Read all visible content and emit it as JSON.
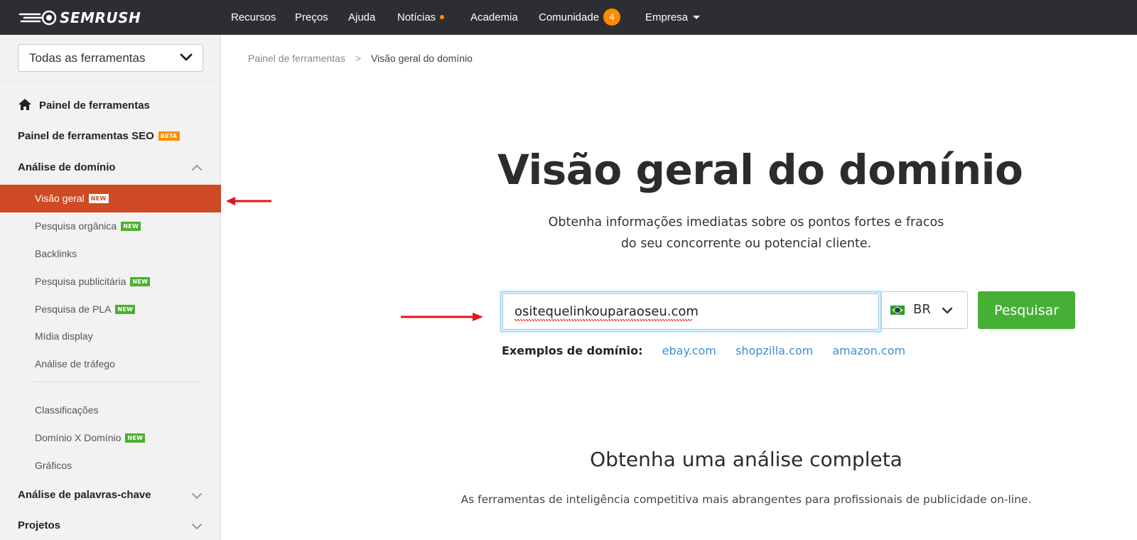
{
  "brand": {
    "logo_text": "SEMRUSH"
  },
  "topnav": {
    "items": [
      {
        "label": "Recursos"
      },
      {
        "label": "Preços"
      },
      {
        "label": "Ajuda"
      },
      {
        "label": "Notícias"
      },
      {
        "label": "Academia"
      },
      {
        "label": "Comunidade",
        "count": "4"
      },
      {
        "label": "Empresa"
      }
    ]
  },
  "sidebar": {
    "tool_select": "Todas as ferramentas",
    "items": [
      {
        "label": "Painel de ferramentas"
      },
      {
        "label": "Painel de ferramentas SEO",
        "badge": "BETA"
      },
      {
        "label": "Análise de domínio"
      },
      {
        "label": "Visão geral",
        "badge": "NEW",
        "active": true
      },
      {
        "label": "Pesquisa orgânica",
        "badge": "NEW"
      },
      {
        "label": "Backlinks"
      },
      {
        "label": "Pesquisa publicitária",
        "badge": "NEW"
      },
      {
        "label": "Pesquisa de PLA",
        "badge": "NEW"
      },
      {
        "label": "Mídia display"
      },
      {
        "label": "Análise de tráfego"
      },
      {
        "label": "Classificações"
      },
      {
        "label": "Domínio X Domínio",
        "badge": "NEW"
      },
      {
        "label": "Gráficos"
      },
      {
        "label": "Análise de palavras-chave"
      },
      {
        "label": "Projetos"
      }
    ]
  },
  "breadcrumb": {
    "parent": "Painel de ferramentas",
    "current": "Visão geral do domínio"
  },
  "hero": {
    "title": "Visão geral do domínio",
    "subtitle_line1": "Obtenha informações imediatas sobre os pontos fortes e fracos",
    "subtitle_line2": "do seu concorrente ou potencial cliente."
  },
  "search": {
    "value": "ositequelinkouparaoseu.com",
    "database": "BR",
    "button": "Pesquisar"
  },
  "examples": {
    "label": "Exemplos de domínio:",
    "links": [
      "ebay.com",
      "shopzilla.com",
      "amazon.com"
    ]
  },
  "section": {
    "title": "Obtenha uma análise completa",
    "subtitle": "As ferramentas de inteligência competitiva mais abrangentes para profissionais de publicidade on-line."
  },
  "colors": {
    "topbar": "#2c2e33",
    "accent_orange": "#ff8c00",
    "active_item": "#cf4a25",
    "primary_green": "#46b035",
    "link_blue": "#3a8fd6",
    "annotation_red": "#e0141e"
  }
}
